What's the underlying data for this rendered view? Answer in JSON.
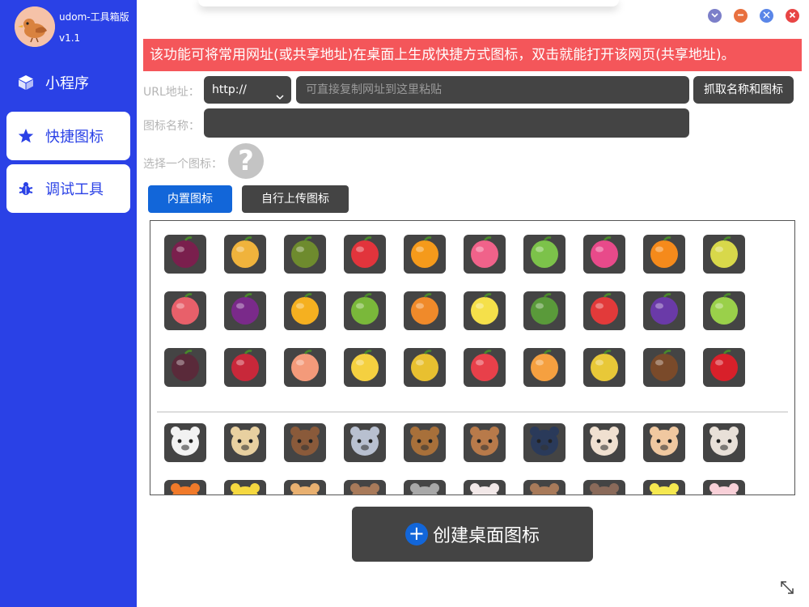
{
  "app": {
    "name": "udom-工具箱版",
    "version": "v1.1"
  },
  "sidebar": {
    "items": [
      {
        "label": "小程序",
        "icon": "cube-icon"
      },
      {
        "label": "快捷图标",
        "icon": "star-icon"
      },
      {
        "label": "调试工具",
        "icon": "bug-icon"
      }
    ]
  },
  "window_controls": {
    "colors": [
      "#7c7fc9",
      "#e8703f",
      "#5a86e8",
      "#e84545"
    ]
  },
  "banner": {
    "text": "该功能可将常用网址(或共享地址)在桌面上生成快捷方式图标，双击就能打开该网页(共享地址)。",
    "color": "#f4565a"
  },
  "form": {
    "url_label": "URL地址：",
    "protocol": "http://",
    "url_placeholder": "可直接复制网址到这里粘贴",
    "fetch_label": "抓取名称和图标",
    "name_label": "图标名称：",
    "choose_label": "选择一个图标："
  },
  "tabs": {
    "builtin": "内置图标",
    "upload": "自行上传图标"
  },
  "icons": {
    "fruits_row1": [
      "passion-fruit-icon",
      "pineapple-icon",
      "durian-icon",
      "strawberry-icon",
      "orange-slice-icon",
      "raspberry-icon",
      "melon-slice-icon",
      "dragon-fruit-icon",
      "orange-icon",
      "durian-half-icon"
    ],
    "fruits_row2": [
      "lychee-icon",
      "plum-icon",
      "mango-icon",
      "kiwi-icon",
      "papaya-icon",
      "lemon-icon",
      "avocado-icon",
      "apple-icon",
      "grapes-icon",
      "lime-icon"
    ],
    "fruits_row3": [
      "mangosteen-icon",
      "pomegranate-icon",
      "peach-icon",
      "banana-icon",
      "pear-icon",
      "watermelon-icon",
      "apricot-icon",
      "starfruit-icon",
      "coconut-icon",
      "cherry-icon"
    ],
    "animals_row1": [
      "panda-icon",
      "seal-icon",
      "walrus-icon",
      "koala-icon",
      "owl-icon",
      "cow-icon",
      "penguin-icon",
      "hamster-icon",
      "pig-icon",
      "monkey-icon"
    ],
    "animals_row2": [
      "fox-icon",
      "chick-icon",
      "tiger-icon",
      "deer-icon",
      "rhino-icon",
      "rabbit-icon",
      "bear-icon",
      "yak-icon",
      "duck-icon",
      "pig-pink-icon"
    ]
  },
  "create_button": {
    "label": "创建桌面图标"
  }
}
